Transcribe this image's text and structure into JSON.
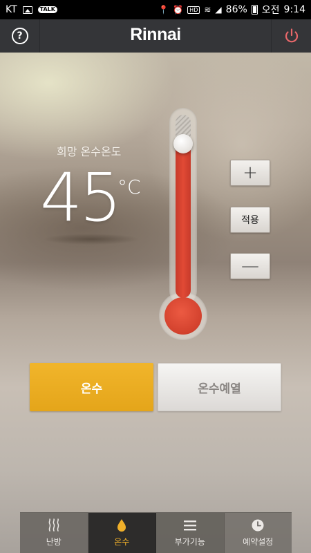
{
  "status_bar": {
    "carrier": "KT",
    "battery": "86%",
    "am_pm": "오전",
    "time": "9:14"
  },
  "header": {
    "logo": "Rinnai",
    "help_icon": "help-icon",
    "power_icon": "power-icon",
    "power_color": "#e8676a"
  },
  "temperature": {
    "label": "희망 온수온도",
    "value": "45",
    "unit": "°C",
    "level_fraction": 0.84
  },
  "controls": {
    "plus_label": "+",
    "apply_label": "적용",
    "minus_label": "—"
  },
  "modes": {
    "hotwater_label": "온수",
    "preheat_label": "온수예열",
    "accent": "#e9aa1f"
  },
  "nav": {
    "items": [
      {
        "label": "난방",
        "icon": "heat-waves-icon"
      },
      {
        "label": "온수",
        "icon": "water-drop-icon"
      },
      {
        "label": "부가기능",
        "icon": "menu-lines-icon"
      },
      {
        "label": "예약설정",
        "icon": "clock-icon"
      }
    ],
    "active_index": 1
  }
}
